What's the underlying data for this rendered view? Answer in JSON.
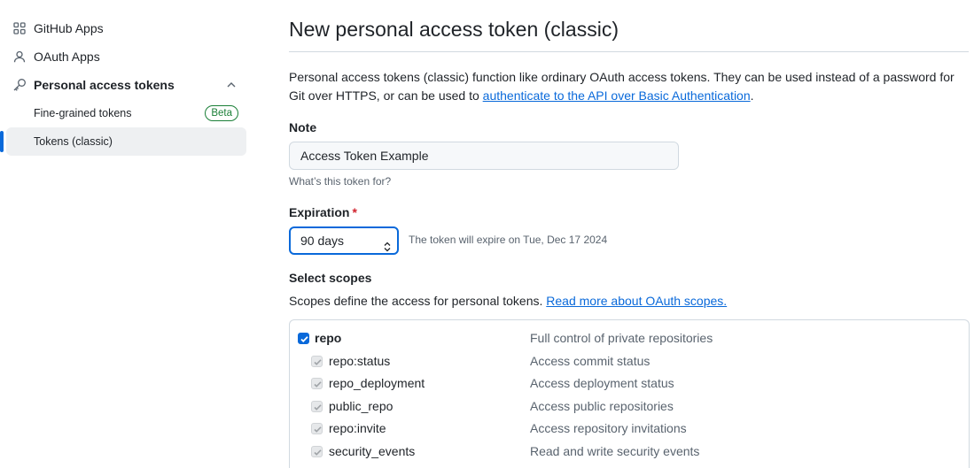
{
  "sidebar": {
    "items": [
      {
        "label": "GitHub Apps",
        "icon": "apps-grid-icon"
      },
      {
        "label": "OAuth Apps",
        "icon": "person-icon"
      },
      {
        "label": "Personal access tokens",
        "icon": "key-icon"
      }
    ],
    "sub_items": [
      {
        "label": "Fine-grained tokens",
        "badge": "Beta"
      },
      {
        "label": "Tokens (classic)"
      }
    ]
  },
  "main": {
    "title": "New personal access token (classic)",
    "description_text": "Personal access tokens (classic) function like ordinary OAuth access tokens. They can be used instead of a password for Git over HTTPS, or can be used to ",
    "description_link": "authenticate to the API over Basic Authentication",
    "description_end": ".",
    "note": {
      "label": "Note",
      "value": "Access Token Example",
      "hint": "What’s this token for?"
    },
    "expiration": {
      "label": "Expiration",
      "required_mark": "*",
      "selected": "90 days",
      "note": "The token will expire on Tue, Dec 17 2024"
    },
    "scopes": {
      "label": "Select scopes",
      "description": "Scopes define the access for personal tokens. ",
      "link": "Read more about OAuth scopes.",
      "rows": [
        {
          "name": "repo",
          "desc": "Full control of private repositories"
        },
        {
          "name": "repo:status",
          "desc": "Access commit status"
        },
        {
          "name": "repo_deployment",
          "desc": "Access deployment status"
        },
        {
          "name": "public_repo",
          "desc": "Access public repositories"
        },
        {
          "name": "repo:invite",
          "desc": "Access repository invitations"
        },
        {
          "name": "security_events",
          "desc": "Read and write security events"
        }
      ]
    }
  },
  "colors": {
    "accent": "#0969da",
    "success": "#1a7f37",
    "danger": "#d1242f"
  }
}
